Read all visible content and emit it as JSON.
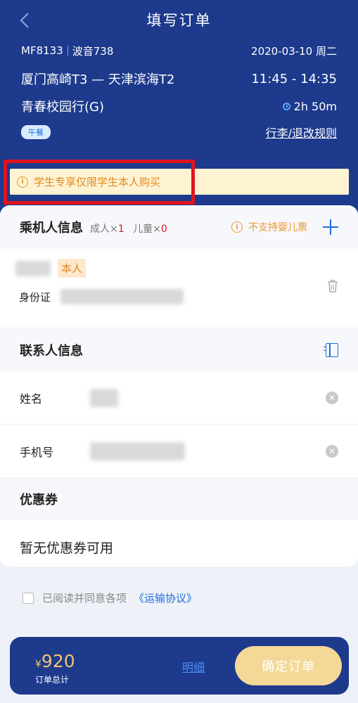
{
  "nav": {
    "title": "填写订单"
  },
  "flight": {
    "number": "MF8133",
    "aircraft": "波音738",
    "date": "2020-03-10 周二",
    "route": "厦门高崎T3 — 天津滨海T2",
    "time": "11:45 - 14:35",
    "product": "青春校园行(G)",
    "duration": "2h 50m",
    "meal": "午餐",
    "rules_link": "行李/退改规则"
  },
  "notice": {
    "text": "学生专享仅限学生本人购买",
    "icon": "warning-icon"
  },
  "passenger_section": {
    "title": "乘机人信息",
    "adult_label": "成人×",
    "adult_count": "1",
    "child_label": "儿童×",
    "child_count": "0",
    "infant_note": "不支持婴儿票",
    "passenger": {
      "tag": "本人",
      "id_type": "身份证"
    }
  },
  "contact_section": {
    "title": "联系人信息",
    "name_label": "姓名",
    "phone_label": "手机号"
  },
  "coupon_section": {
    "title": "优惠券",
    "empty_text": "暂无优惠券可用"
  },
  "agreement": {
    "text": "已阅读并同意各项",
    "link": "《运输协议》"
  },
  "bottom_bar": {
    "currency": "¥",
    "amount": "920",
    "total_label": "订单总计",
    "detail_link": "明细",
    "confirm_label": "确定订单"
  },
  "colors": {
    "header_bg": "#1d3a8c",
    "accent_blue": "#1e6fe0",
    "warning_orange": "#e08a1e",
    "highlight_red": "#e0141e",
    "price_gold": "#f2c46e",
    "confirm_bg": "#f3d898"
  }
}
